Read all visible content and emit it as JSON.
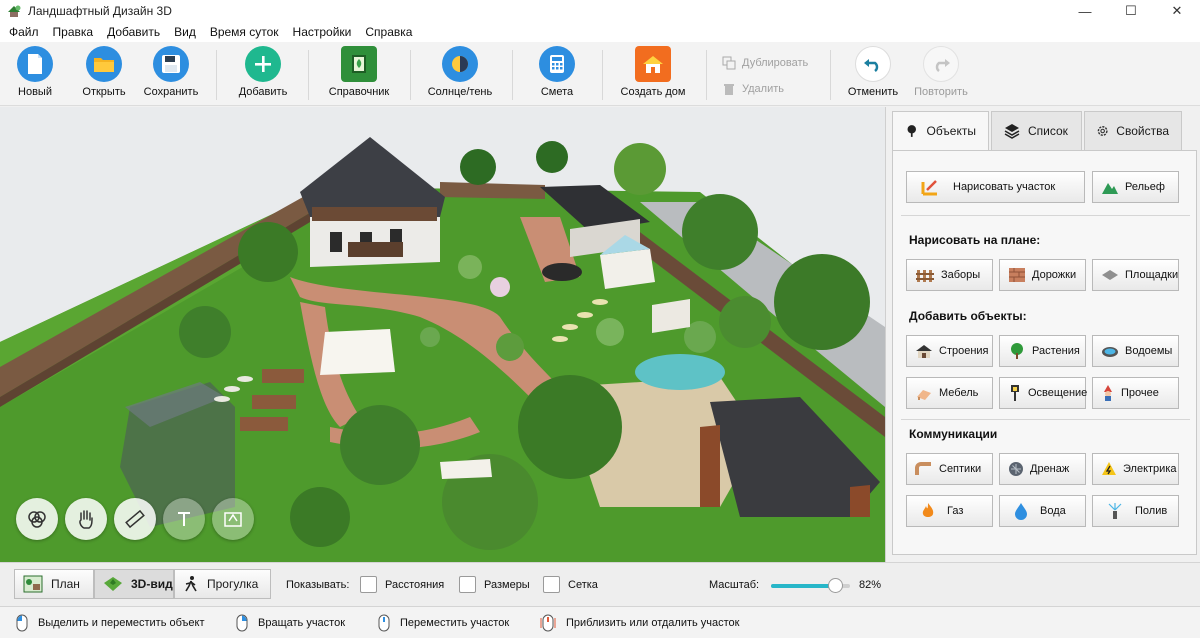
{
  "window": {
    "title": "Ландшафтный Дизайн 3D",
    "controls": {
      "minimize": "—",
      "maximize": "☐",
      "close": "✕"
    }
  },
  "menu": [
    "Файл",
    "Правка",
    "Добавить",
    "Вид",
    "Время суток",
    "Настройки",
    "Справка"
  ],
  "toolbar": {
    "new": "Новый",
    "open": "Открыть",
    "save": "Сохранить",
    "add": "Добавить",
    "reference": "Справочник",
    "sun_shade": "Солнце/тень",
    "estimate": "Смета",
    "create_house": "Создать дом",
    "duplicate": "Дублировать",
    "delete": "Удалить",
    "undo": "Отменить",
    "redo": "Повторить"
  },
  "panel": {
    "tabs": [
      "Объекты",
      "Список",
      "Свойства"
    ],
    "active_tab": "Объекты",
    "draw_plot": "Нарисовать участок",
    "relief": "Рельеф",
    "draw_on_plan_title": "Нарисовать на плане:",
    "draw_on_plan": [
      "Заборы",
      "Дорожки",
      "Площадки"
    ],
    "add_objects_title": "Добавить объекты:",
    "add_objects": [
      "Строения",
      "Растения",
      "Водоемы",
      "Мебель",
      "Освещение",
      "Прочее"
    ],
    "communications_title": "Коммуникации",
    "communications": [
      "Септики",
      "Дренаж",
      "Электрика",
      "Газ",
      "Вода",
      "Полив"
    ]
  },
  "viewbar": {
    "modes": [
      "План",
      "3D-вид",
      "Прогулка"
    ],
    "active_mode": "3D-вид",
    "show_label": "Показывать:",
    "checkboxes": [
      {
        "label": "Расстояния",
        "checked": false
      },
      {
        "label": "Размеры",
        "checked": false
      },
      {
        "label": "Сетка",
        "checked": false
      }
    ],
    "scale_label": "Масштаб:",
    "scale_value": "82%",
    "scale_fraction": 0.82
  },
  "statusbar": {
    "hints": [
      "Выделить и переместить объект",
      "Вращать участок",
      "Переместить участок",
      "Приблизить или отдалить участок"
    ]
  },
  "colors": {
    "accent": "#27b6c8",
    "grass": "#4e9a2c",
    "path": "#c98e74",
    "roof": "#3d3f45"
  }
}
